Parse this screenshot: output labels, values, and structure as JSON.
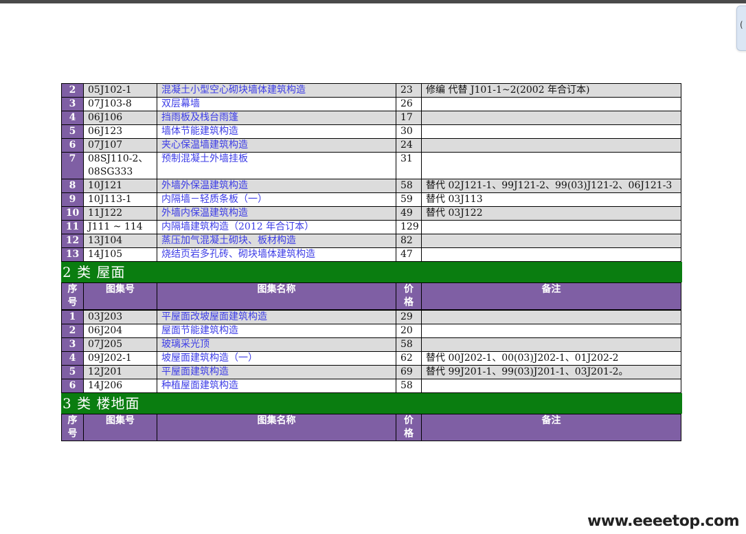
{
  "side_tab": {
    "label": "("
  },
  "rows_cat1": [
    {
      "idx": "2",
      "code": "05J102-1",
      "name": "混凝土小型空心砌块墙体建筑构造",
      "price": "23",
      "note": "修编 代替 J101-1~2(2002 年合订本)"
    },
    {
      "idx": "3",
      "code": "07J103-8",
      "name": "双层幕墙",
      "price": "26",
      "note": ""
    },
    {
      "idx": "4",
      "code": "06J106",
      "name": "挡雨板及栈台雨篷",
      "price": "17",
      "note": ""
    },
    {
      "idx": "5",
      "code": "06J123",
      "name": "墙体节能建筑构造",
      "price": "30",
      "note": ""
    },
    {
      "idx": "6",
      "code": "07J107",
      "name": "夹心保温墙建筑构造",
      "price": "24",
      "note": ""
    },
    {
      "idx": "7",
      "code": "08SJ110-2、",
      "code2": "08SG333",
      "name": "预制混凝土外墙挂板",
      "price": "31",
      "note": ""
    },
    {
      "idx": "8",
      "code": "10J121",
      "name": "外墙外保温建筑构造",
      "price": "58",
      "note": "替代 02J121-1、99J121-2、99(03)J121-2、06J121-3"
    },
    {
      "idx": "9",
      "code": "10J113-1",
      "name": "内隔墙－轻质条板（一）",
      "price": "59",
      "note": "替代 03J113"
    },
    {
      "idx": "10",
      "code": "11J122",
      "name": "外墙内保温建筑构造",
      "price": "49",
      "note": "替代 03J122"
    },
    {
      "idx": "11",
      "code": "J111 ~ 114",
      "name": "内隔墙建筑构造（2012 年合订本）",
      "price": "129",
      "note": ""
    },
    {
      "idx": "12",
      "code": "13J104",
      "name": "蒸压加气混凝土砌块、板材构造",
      "price": "82",
      "note": ""
    },
    {
      "idx": "13",
      "code": "14J105",
      "name": "烧结页岩多孔砖、砌块墙体建筑构造",
      "price": "47",
      "note": ""
    }
  ],
  "category2": {
    "title": "2 类  屋面"
  },
  "header": {
    "idx_line1": "序",
    "idx_line2": "号",
    "code": "图集号",
    "name": "图集名称",
    "price_line1": "价",
    "price_line2": "格",
    "note": "备注"
  },
  "rows_cat2": [
    {
      "idx": "1",
      "code": "03J203",
      "name": "平屋面改坡屋面建筑构造",
      "price": "29",
      "note": ""
    },
    {
      "idx": "2",
      "code": "06J204",
      "name": "屋面节能建筑构造",
      "price": "20",
      "note": ""
    },
    {
      "idx": "3",
      "code": "07J205",
      "name": "玻璃采光顶",
      "price": "58",
      "note": ""
    },
    {
      "idx": "4",
      "code": "09J202-1",
      "name": "坡屋面建筑构造（一）",
      "price": "62",
      "note": "替代 00J202-1、00(03)J202-1、01J202-2"
    },
    {
      "idx": "5",
      "code": "12J201",
      "name": "平屋面建筑构造",
      "price": "69",
      "note": "替代 99J201-1、99(03)J201-1、03J201-2。"
    },
    {
      "idx": "6",
      "code": "14J206",
      "name": "种植屋面建筑构造",
      "price": "58",
      "note": ""
    }
  ],
  "category3": {
    "title": "3 类  楼地面"
  },
  "watermark": {
    "text": "www.eeeetop.com"
  },
  "colors": {
    "index_purple": "#7f5fa4",
    "category_green": "#0a7d10",
    "link_blue": "#3c3ce6",
    "row_shade": "#dcdcdc"
  }
}
